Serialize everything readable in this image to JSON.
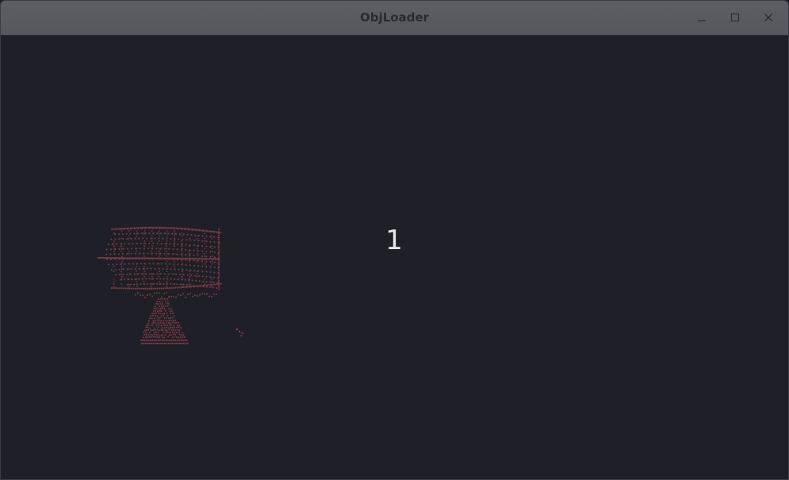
{
  "window": {
    "title": "ObjLoader",
    "controls": [
      "minimize",
      "maximize",
      "close"
    ]
  },
  "viewport": {
    "counter_text": "1",
    "model": {
      "description_icon": "point-cloud-model-icon",
      "point_color": "#7a3a44"
    },
    "background_color": "#1f2027"
  },
  "colors": {
    "titlebar": "#595b61",
    "title_text": "#2a2b30",
    "counter_text": "#e6e6e6"
  }
}
